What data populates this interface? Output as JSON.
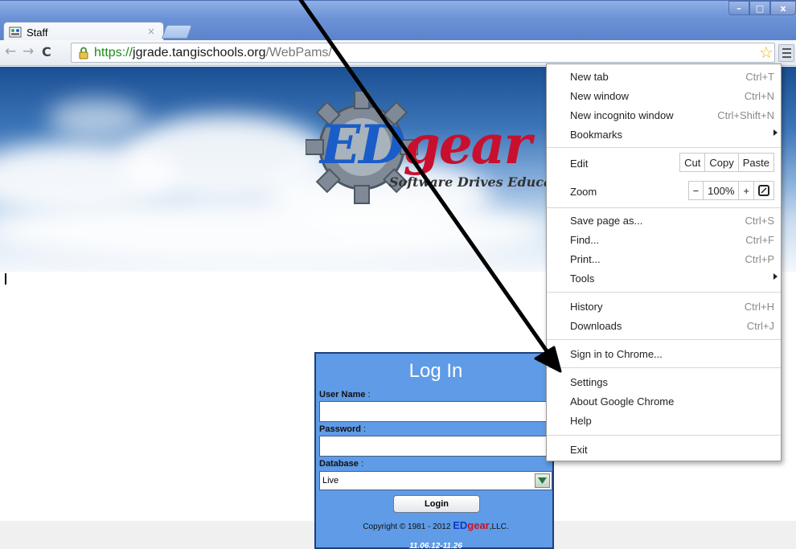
{
  "window": {
    "tab_title": "Staff",
    "tab_close": "×",
    "minimize_glyph": "–",
    "maximize_glyph": "□",
    "close_glyph": "x"
  },
  "toolbar": {
    "back_glyph": "←",
    "forward_glyph": "→",
    "reload_glyph": "C",
    "url_scheme": "https://",
    "url_host": "jgrade.tangischools.org",
    "url_path": "/WebPams/",
    "star_glyph": "☆"
  },
  "page": {
    "logo_ed": "ED",
    "logo_gear": "gear",
    "logo_tagline": "Software Drives Education",
    "login": {
      "title": "Log In",
      "username_label": "User Name",
      "username_value": "",
      "password_label": "Password",
      "password_value": "",
      "database_label": "Database",
      "database_value": "Live",
      "label_colon": ":",
      "login_button": "Login",
      "copyright_prefix": "Copyright © 1981 - 2012",
      "copyright_ed": "ED",
      "copyright_gear": "gear",
      "copyright_suffix": ",LLC.",
      "version": "11.06.12-11.26"
    }
  },
  "menu": {
    "new_tab": {
      "label": "New tab",
      "shortcut": "Ctrl+T"
    },
    "new_window": {
      "label": "New window",
      "shortcut": "Ctrl+N"
    },
    "new_incognito": {
      "label": "New incognito window",
      "shortcut": "Ctrl+Shift+N"
    },
    "bookmarks": {
      "label": "Bookmarks"
    },
    "edit": {
      "label": "Edit",
      "cut": "Cut",
      "copy": "Copy",
      "paste": "Paste"
    },
    "zoom": {
      "label": "Zoom",
      "minus": "−",
      "level": "100%",
      "plus": "+"
    },
    "save_page": {
      "label": "Save page as...",
      "shortcut": "Ctrl+S"
    },
    "find": {
      "label": "Find...",
      "shortcut": "Ctrl+F"
    },
    "print": {
      "label": "Print...",
      "shortcut": "Ctrl+P"
    },
    "tools": {
      "label": "Tools"
    },
    "history": {
      "label": "History",
      "shortcut": "Ctrl+H"
    },
    "downloads": {
      "label": "Downloads",
      "shortcut": "Ctrl+J"
    },
    "sign_in": {
      "label": "Sign in to Chrome..."
    },
    "settings": {
      "label": "Settings"
    },
    "about": {
      "label": "About Google Chrome"
    },
    "help": {
      "label": "Help"
    },
    "exit": {
      "label": "Exit"
    }
  }
}
